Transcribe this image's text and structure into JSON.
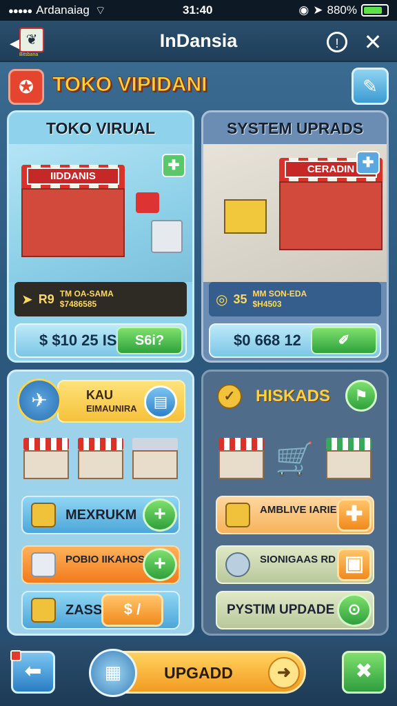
{
  "status": {
    "carrier": "Ardanaiag",
    "time": "31:40",
    "battery_text": "880%"
  },
  "header": {
    "title": "InDansia",
    "logo_caption": "Bitsbana"
  },
  "shop": {
    "title": "TOKO VIPIDANI"
  },
  "card_toko": {
    "title": "TOKO VIRUAL",
    "sign": "IIDDANIS",
    "level": "R9",
    "line1": "TM OA-SAMA",
    "line2": "$7486585",
    "price": "$ $10 25 IS",
    "buy_label": "S6i?"
  },
  "card_system": {
    "title": "SYSTEM UPRADS",
    "sign": "CERADIN",
    "level": "35",
    "line1": "MM SON-EDA",
    "line2": "$H4503",
    "price": "$0 668 12"
  },
  "card_kau": {
    "label1": "KAU",
    "label2": "EIMAUNIRA",
    "options": [
      {
        "label": "MEXRUKM"
      },
      {
        "label": "POBIO IIKAHOS DOIA"
      },
      {
        "label": "ZASSG",
        "action": "$ /"
      }
    ]
  },
  "card_hiskads": {
    "title": "HISKADS",
    "options": [
      {
        "label": "AMBLIVE IARIE IIOIII"
      },
      {
        "label": "SIONIGAAS RD"
      },
      {
        "label": "PYSTIM UPDADE"
      }
    ]
  },
  "bottom": {
    "main_label": "UPGADD"
  }
}
